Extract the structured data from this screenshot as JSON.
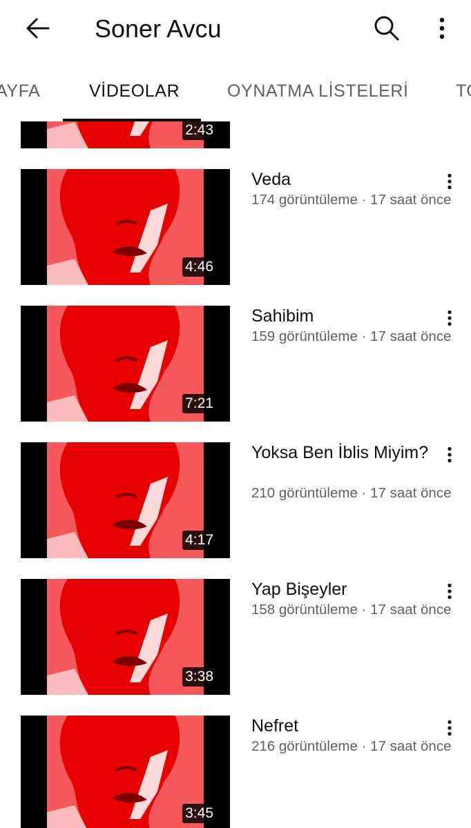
{
  "header": {
    "title": "Soner Avcu",
    "back_icon": "arrow-left-icon",
    "search_icon": "search-icon",
    "more_icon": "more-vertical-icon"
  },
  "tabs": [
    {
      "label": "ANA SAYFA",
      "visible_text": "AYFA",
      "active": false
    },
    {
      "label": "VİDEOLAR",
      "visible_text": "VİDEOLAR",
      "active": true
    },
    {
      "label": "OYNATMA LİSTELERİ",
      "visible_text": "OYNATMA LİSTELERİ",
      "active": false
    },
    {
      "label": "TOPLULUK",
      "visible_text": "TO",
      "active": false
    }
  ],
  "videos": [
    {
      "title": "",
      "duration": "2:43",
      "meta": ""
    },
    {
      "title": "Veda",
      "duration": "4:46",
      "meta": "174 görüntüleme · 17 saat önce"
    },
    {
      "title": "Sahibim",
      "duration": "7:21",
      "meta": "159 görüntüleme · 17 saat önce"
    },
    {
      "title": "Yoksa Ben İblis Miyim?",
      "duration": "4:17",
      "meta": "210 görüntüleme · 17 saat önce"
    },
    {
      "title": "Yap Bişeyler",
      "duration": "3:38",
      "meta": "158 görüntüleme · 17 saat önce"
    },
    {
      "title": "Nefret",
      "duration": "3:45",
      "meta": "216 görüntüleme · 17 saat önce"
    }
  ],
  "colors": {
    "thumbnail_red": "#f4585b",
    "thumbnail_dark_red": "#e60000",
    "secondary_text": "#606060",
    "primary_text": "#0f0f0f"
  }
}
